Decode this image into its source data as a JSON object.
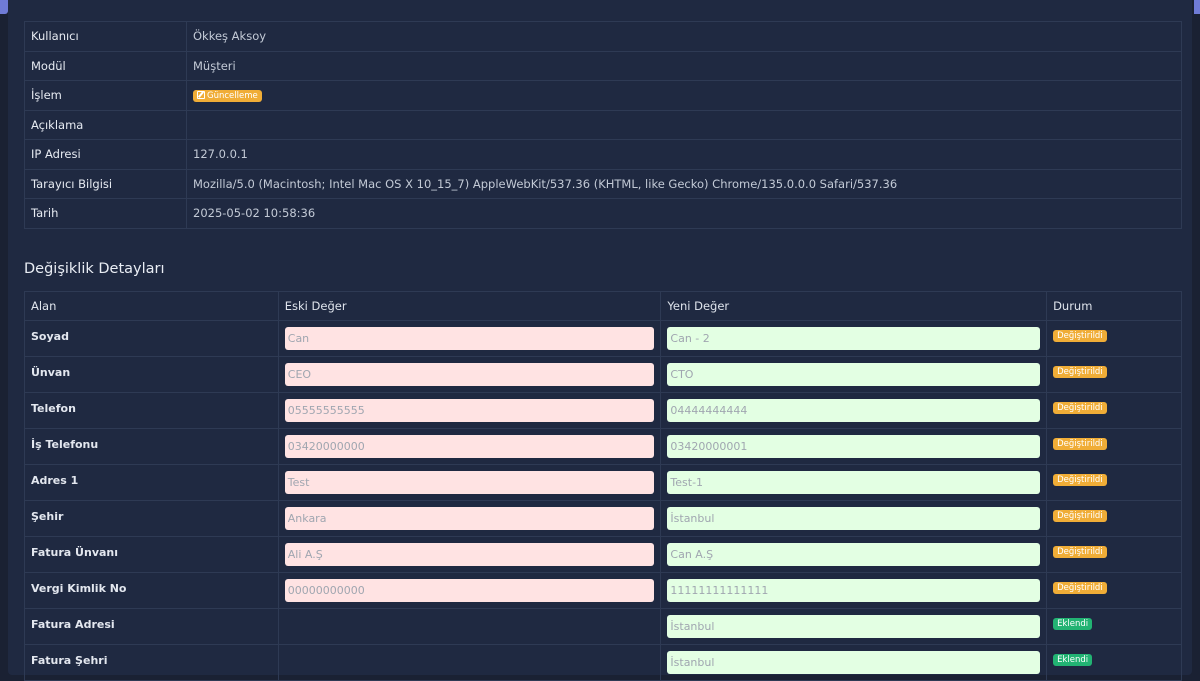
{
  "info": {
    "rows": [
      {
        "label": "Kullanıcı",
        "value": "Ökkeş Aksoy"
      },
      {
        "label": "Modül",
        "value": "Müşteri"
      },
      {
        "label": "İşlem",
        "value": "",
        "badge": "Güncelleme"
      },
      {
        "label": "Açıklama",
        "value": ""
      },
      {
        "label": "IP Adresi",
        "value": "127.0.0.1"
      },
      {
        "label": "Tarayıcı Bilgisi",
        "value": "Mozilla/5.0 (Macintosh; Intel Mac OS X 10_15_7) AppleWebKit/537.36 (KHTML, like Gecko) Chrome/135.0.0.0 Safari/537.36"
      },
      {
        "label": "Tarih",
        "value": "2025-05-02 10:58:36"
      }
    ]
  },
  "changes": {
    "title": "Değişiklik Detayları",
    "headers": {
      "field": "Alan",
      "old": "Eski Değer",
      "new": "Yeni Değer",
      "status": "Durum"
    },
    "rows": [
      {
        "field": "Soyad",
        "old": "Can",
        "new": "Can - 2",
        "status": "Değiştirildi",
        "kind": "changed"
      },
      {
        "field": "Ünvan",
        "old": "CEO",
        "new": "CTO",
        "status": "Değiştirildi",
        "kind": "changed"
      },
      {
        "field": "Telefon",
        "old": "05555555555",
        "new": "04444444444",
        "status": "Değiştirildi",
        "kind": "changed"
      },
      {
        "field": "İş Telefonu",
        "old": "03420000000",
        "new": "03420000001",
        "status": "Değiştirildi",
        "kind": "changed"
      },
      {
        "field": "Adres 1",
        "old": "Test",
        "new": "Test-1",
        "status": "Değiştirildi",
        "kind": "changed"
      },
      {
        "field": "Şehir",
        "old": "Ankara",
        "new": "İstanbul",
        "status": "Değiştirildi",
        "kind": "changed"
      },
      {
        "field": "Fatura Ünvanı",
        "old": "Ali A.Ş",
        "new": "Can A.Ş",
        "status": "Değiştirildi",
        "kind": "changed"
      },
      {
        "field": "Vergi Kimlik No",
        "old": "00000000000",
        "new": "11111111111111",
        "status": "Değiştirildi",
        "kind": "changed"
      },
      {
        "field": "Fatura Adresi",
        "old": null,
        "new": "İstanbul",
        "status": "Eklendi",
        "kind": "added"
      },
      {
        "field": "Fatura Şehri",
        "old": null,
        "new": "İstanbul",
        "status": "Eklendi",
        "kind": "added"
      }
    ]
  },
  "colors": {
    "background": "#1a2133",
    "panel": "#1f2941",
    "border": "#2e3a54",
    "old_value_bg": "#ffe3e3",
    "new_value_bg": "#e3ffe3",
    "badge_changed": "#f0ad37",
    "badge_added": "#22b373",
    "accent": "#6f7bd6"
  },
  "icons": {
    "update_badge": "edit-icon"
  }
}
